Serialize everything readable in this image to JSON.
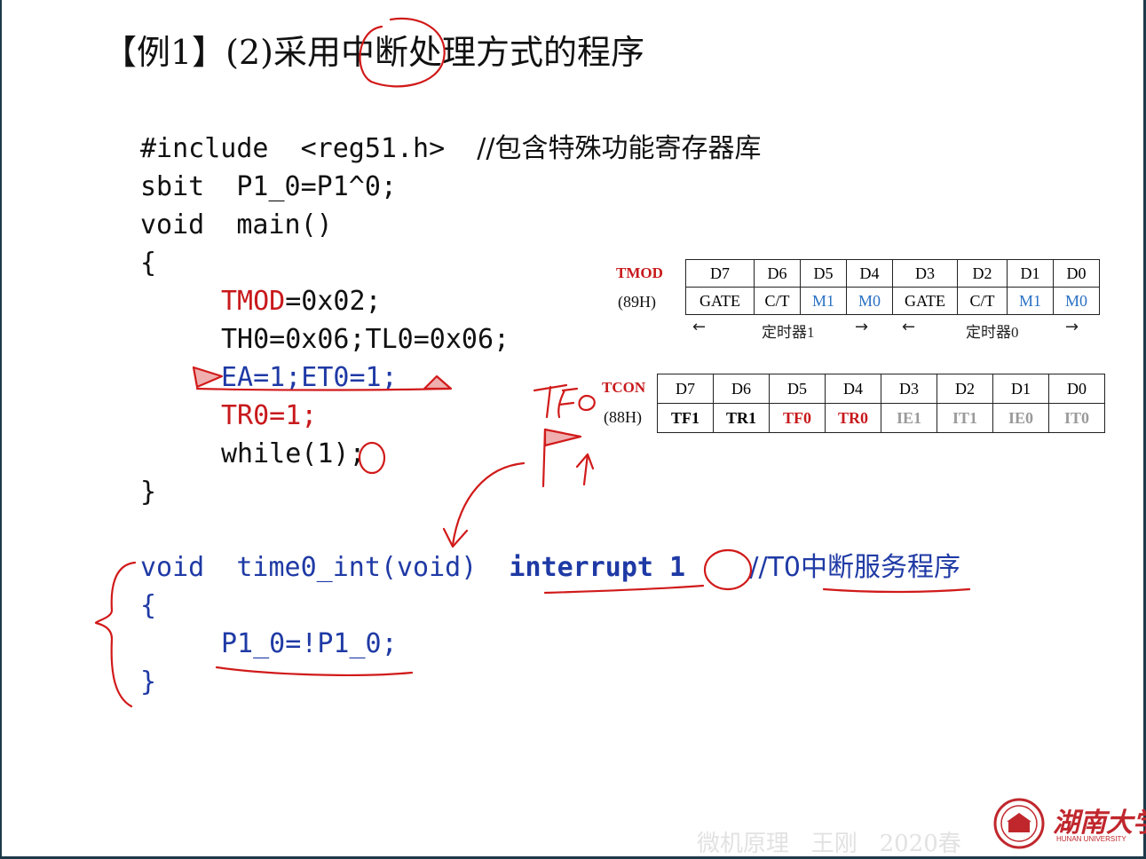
{
  "title": "【例1】(2)采用中断处理方式的程序",
  "code": {
    "line1_a": "#include  <reg51.h>  ",
    "line1_comment": "//包含特殊功能寄存器库",
    "line2": "sbit  P1_0=P1^0;",
    "line3": "void  main()",
    "line4": "{",
    "line5_red": "TMOD",
    "line5_rest": "=0x02;",
    "line6": "TH0=0x06;TL0=0x06;",
    "line7": "EA=1;ET0=1;",
    "line8": "TR0=1;",
    "line9": "while(1);",
    "line10": "}",
    "isr_line1_a": "void  time0_int(void)  ",
    "isr_line1_kw": "interrupt",
    "isr_line1_num": " 1",
    "isr_line1_comment": "//T0中断服务程序",
    "isr_line2": "{",
    "isr_line3": "P1_0=!P1_0;",
    "isr_line4": "}"
  },
  "tmod": {
    "name": "TMOD",
    "addr": "(89H)",
    "bits": [
      "D7",
      "D6",
      "D5",
      "D4",
      "D3",
      "D2",
      "D1",
      "D0"
    ],
    "values": [
      "GATE",
      "C/T",
      "M1",
      "M0",
      "GATE",
      "C/T",
      "M1",
      "M0"
    ],
    "timer1_label": "定时器1",
    "timer0_label": "定时器0",
    "arrow_left": "←",
    "arrow_right": "→"
  },
  "tcon": {
    "name": "TCON",
    "addr": "(88H)",
    "bits": [
      "D7",
      "D6",
      "D5",
      "D4",
      "D3",
      "D2",
      "D1",
      "D0"
    ],
    "values": [
      "TF1",
      "TR1",
      "TF0",
      "TR0",
      "IE1",
      "IT1",
      "IE0",
      "IT0"
    ]
  },
  "annotations": {
    "handwritten_tf0": "TFo"
  },
  "watermark": "微机原理   王刚   2020春",
  "logo": {
    "name": "湖南大学",
    "sub": "HUNAN UNIVERSITY"
  },
  "colors": {
    "red": "#c8191c",
    "blue": "#1f3aa5",
    "light_blue": "#2a72c4",
    "gray": "#9a9a9a"
  }
}
